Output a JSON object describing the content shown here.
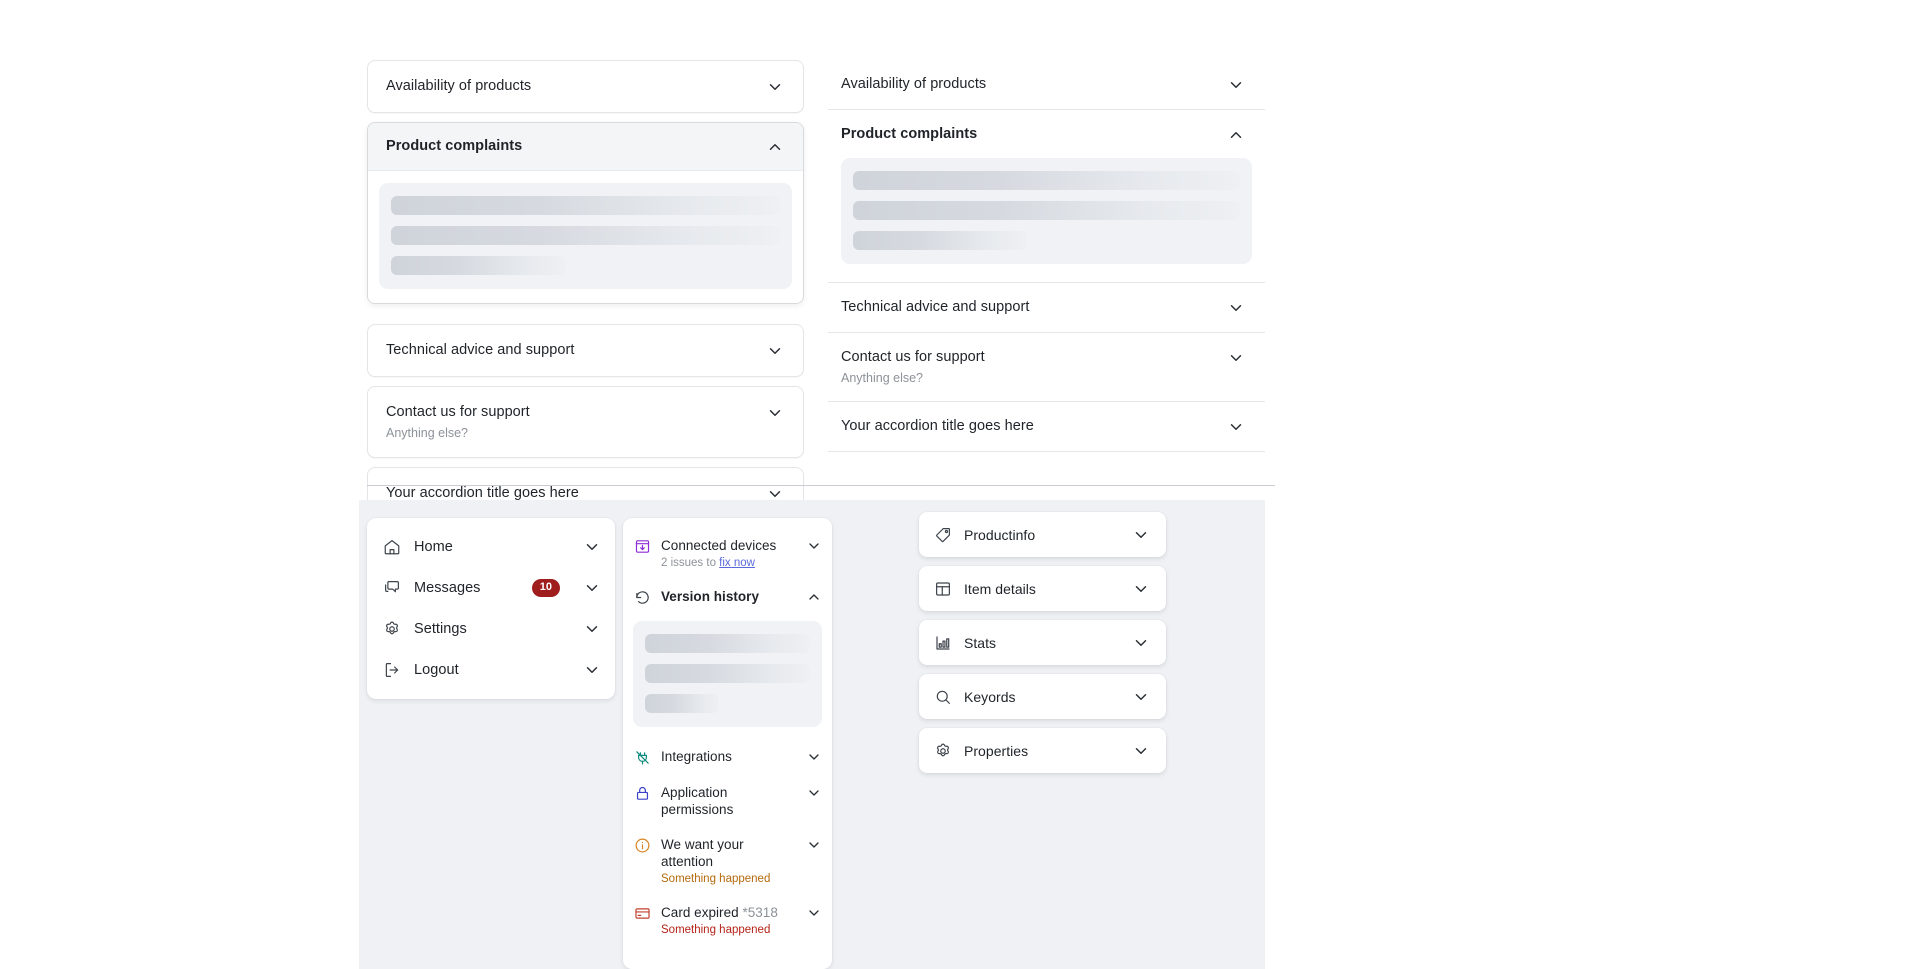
{
  "accordion_left": {
    "items": [
      {
        "title": "Availability of products",
        "subtitle": "",
        "expanded": false,
        "icon": "chevron-down-icon"
      },
      {
        "title": "Product complaints",
        "subtitle": "",
        "expanded": true,
        "icon": "chevron-up-icon"
      },
      {
        "title": "Technical advice and support",
        "subtitle": "",
        "expanded": false,
        "icon": "chevron-down-icon"
      },
      {
        "title": "Contact us for support",
        "subtitle": "Anything else?",
        "expanded": false,
        "icon": "chevron-down-icon"
      },
      {
        "title": "Your accordion title goes here",
        "subtitle": "",
        "expanded": false,
        "icon": "chevron-down-icon"
      }
    ]
  },
  "accordion_right": {
    "items": [
      {
        "title": "Availability of products",
        "subtitle": "",
        "expanded": false,
        "icon": "chevron-down-icon"
      },
      {
        "title": "Product complaints",
        "subtitle": "",
        "expanded": true,
        "icon": "chevron-up-icon"
      },
      {
        "title": "Technical advice and support",
        "subtitle": "",
        "expanded": false,
        "icon": "chevron-down-icon"
      },
      {
        "title": "Contact us for support",
        "subtitle": "Anything else?",
        "expanded": false,
        "icon": "chevron-down-icon"
      },
      {
        "title": "Your accordion title goes here",
        "subtitle": "",
        "expanded": false,
        "icon": "chevron-down-icon"
      }
    ]
  },
  "nav_menu": {
    "items": [
      {
        "label": "Home",
        "icon": "home-icon",
        "badge": ""
      },
      {
        "label": "Messages",
        "icon": "messages-icon",
        "badge": "10"
      },
      {
        "label": "Settings",
        "icon": "gear-icon",
        "badge": ""
      },
      {
        "label": "Logout",
        "icon": "logout-icon",
        "badge": ""
      }
    ]
  },
  "middle_list": {
    "items": [
      {
        "title": "Connected devices",
        "sub_prefix": "2 issues to ",
        "sub_link": "fix now",
        "icon": "connected-devices-icon",
        "icon_color": "#8b2fd6",
        "expanded": false,
        "bold": false
      },
      {
        "title": "Version history",
        "sub_prefix": "",
        "sub_link": "",
        "icon": "version-history-icon",
        "icon_color": "#3e444c",
        "expanded": true,
        "bold": true
      },
      {
        "title": "Integrations",
        "sub_prefix": "",
        "sub_link": "",
        "icon": "integrations-plug-icon",
        "icon_color": "#0f8a7e",
        "expanded": false,
        "bold": false
      },
      {
        "title": "Application permissions",
        "sub_prefix": "",
        "sub_link": "",
        "icon": "lock-icon",
        "icon_color": "#3a41c7",
        "expanded": false,
        "bold": false
      },
      {
        "title": "We want your attention",
        "sub_prefix": "Something happened",
        "sub_link": "",
        "sub_tone": "orange",
        "icon": "info-circle-icon",
        "icon_color": "#d98321",
        "expanded": false,
        "bold": false
      },
      {
        "title": "Card expired ",
        "title_suffix": "*5318",
        "sub_prefix": "Something happened",
        "sub_link": "",
        "sub_tone": "red",
        "icon": "credit-card-icon",
        "icon_color": "#c2402f",
        "expanded": false,
        "bold": false
      }
    ]
  },
  "right_stack": {
    "items": [
      {
        "label": "Productinfo",
        "icon": "tag-icon"
      },
      {
        "label": "Item details",
        "icon": "layout-icon"
      },
      {
        "label": "Stats",
        "icon": "bar-chart-icon"
      },
      {
        "label": "Keyords",
        "icon": "search-icon"
      },
      {
        "label": "Properties",
        "icon": "gear-icon"
      }
    ]
  },
  "colors": {
    "badge_red": "#9f1d1d",
    "link_blue": "#5a6bd8",
    "panel_bg": "#eff1f4",
    "skeleton": "#d6dae0",
    "text": "#1f2328",
    "muted": "#8d9299",
    "orange": "#b5690c",
    "red": "#b42318"
  }
}
